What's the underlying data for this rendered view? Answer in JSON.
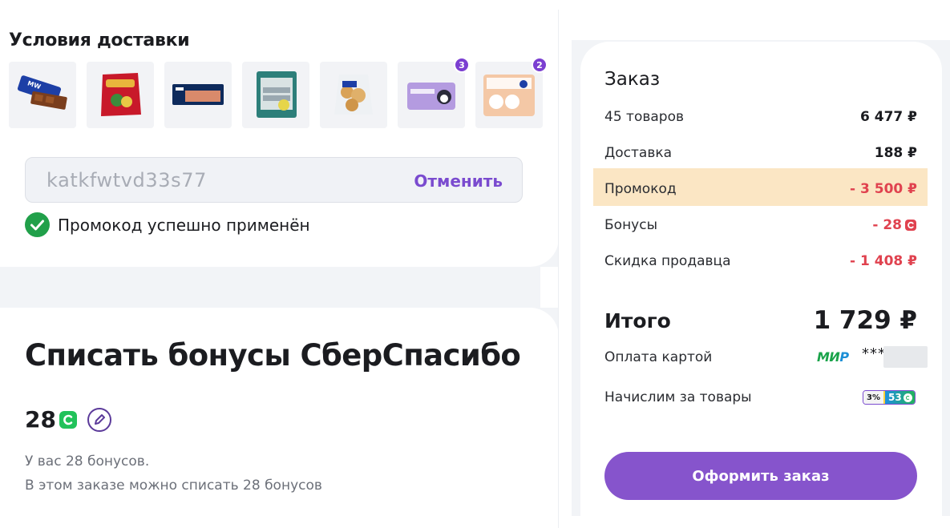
{
  "delivery": {
    "title": "Условия доставки",
    "products": [
      {
        "icon": "chocolate-bar-icon",
        "qty": ""
      },
      {
        "icon": "candy-pack-icon",
        "qty": ""
      },
      {
        "icon": "fish-pack-icon",
        "qty": ""
      },
      {
        "icon": "herring-fillet-icon",
        "qty": ""
      },
      {
        "icon": "pastry-bag-icon",
        "qty": ""
      },
      {
        "icon": "napkins-pack-icon",
        "qty": "3"
      },
      {
        "icon": "toilet-paper-icon",
        "qty": "2"
      }
    ]
  },
  "promo": {
    "code": "katkfwtvd33s77",
    "cancel_label": "Отменить",
    "success_text": "Промокод успешно применён"
  },
  "bonus": {
    "title": "Списать бонусы СберСпасибо",
    "amount": "28",
    "info_available": "У вас 28 бонусов.",
    "info_spendable": "В этом заказе можно списать 28 бонусов"
  },
  "order": {
    "title": "Заказ",
    "rows": [
      {
        "label": "45 товаров",
        "value": "6 477 ₽"
      },
      {
        "label": "Доставка",
        "value": "188 ₽"
      },
      {
        "label": "Промокод",
        "value": "- 3 500 ₽"
      },
      {
        "label": "Бонусы",
        "value": "- 28"
      },
      {
        "label": "Скидка продавца",
        "value": "- 1 408 ₽"
      }
    ],
    "total_label": "Итого",
    "total_value": "1 729 ₽",
    "payment_label": "Оплата картой",
    "payment_system_a": "МИ",
    "payment_system_b": "Р",
    "card_mask": "***",
    "accrual_label": "Начислим за товары",
    "accrual_percent": "3%",
    "accrual_amount": "53",
    "checkout_label": "Оформить заказ"
  },
  "colors": {
    "accent": "#8654cc",
    "discount": "#e0424f",
    "success": "#21a04a",
    "promo_highlight": "#fbe6c4"
  }
}
